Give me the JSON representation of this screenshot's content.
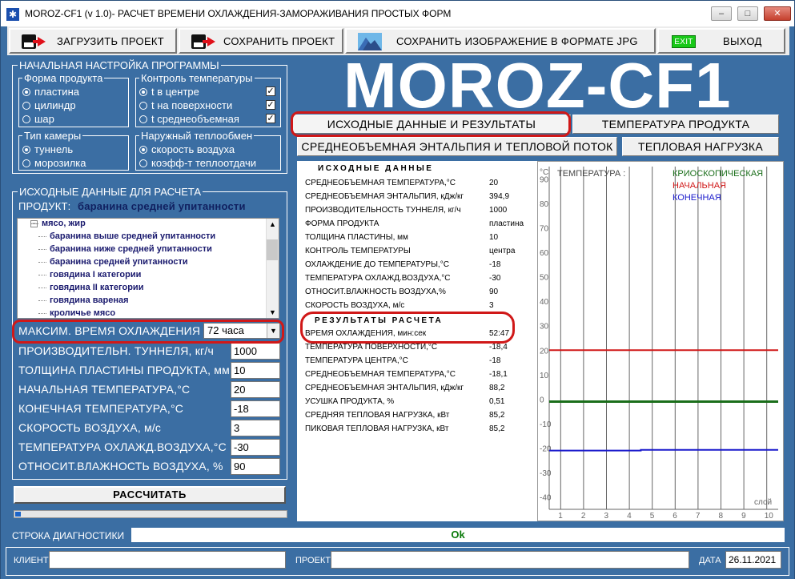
{
  "window": {
    "title": "MOROZ-CF1 (v 1.0)- РАСЧЕТ ВРЕМЕНИ ОХЛАЖДЕНИЯ-ЗАМОРАЖИВАНИЯ ПРОСТЫХ ФОРМ",
    "icon": "snowflake-icon",
    "minimize": "–",
    "maximize": "□",
    "close": "✕"
  },
  "toolbar": {
    "load": "ЗАГРУЗИТЬ  ПРОЕКТ",
    "save": "СОХРАНИТЬ  ПРОЕКТ",
    "save_image": "СОХРАНИТЬ  ИЗОБРАЖЕНИЕ  В  ФОРМАТЕ  JPG",
    "exit_icon": "EXIT",
    "exit": "ВЫХОД"
  },
  "app_title": "MOROZ-CF1",
  "settings": {
    "title": "НАЧАЛЬНАЯ НАСТРОЙКА ПРОГРАММЫ",
    "shape": {
      "title": "Форма продукта",
      "options": [
        "пластина",
        "цилиндр",
        "шар"
      ],
      "selected": 0
    },
    "temp_control": {
      "title": "Контроль температуры",
      "options": [
        "t в центре",
        "t на поверхности",
        "t среднеобъемная"
      ],
      "checked": [
        true,
        true,
        true
      ]
    },
    "chamber": {
      "title": "Тип камеры",
      "options": [
        "туннель",
        "морозилка"
      ],
      "selected": 0
    },
    "heat_exchange": {
      "title": "Наружный теплообмен",
      "options": [
        "скорость воздуха",
        "коэфф-т теплоотдачи"
      ],
      "selected": 0
    }
  },
  "input": {
    "title": "ИСХОДНЫЕ ДАННЫЕ ДЛЯ РАСЧЕТА",
    "product_label": "ПРОДУКТ:",
    "product_value": "баранина средней упитанности",
    "tree": {
      "group": "мясо, жир",
      "items": [
        "баранина выше средней упитанности",
        "баранина ниже средней упитанности",
        "баранина средней упитанности",
        "говядина I категории",
        "говядина II категории",
        "говядина вареная",
        "кроличье мясо"
      ]
    },
    "maxtime_label": "МАКСИМ. ВРЕМЯ ОХЛАЖДЕНИЯ",
    "maxtime_value": "72 часа",
    "fields": [
      {
        "label": "ПРОИЗВОДИТЕЛЬН. ТУННЕЛЯ, кг/ч",
        "value": "1000"
      },
      {
        "label": "ТОЛЩИНА ПЛАСТИНЫ ПРОДУКТА, мм",
        "value": "10"
      },
      {
        "label": "НАЧАЛЬНАЯ ТЕМПЕРАТУРА,°С",
        "value": "20"
      },
      {
        "label": "КОНЕЧНАЯ ТЕМПЕРАТУРА,°С",
        "value": "-18"
      },
      {
        "label": "СКОРОСТЬ ВОЗДУХА, м/с",
        "value": "3"
      },
      {
        "label": "ТЕМПЕРАТУРА ОХЛАЖД.ВОЗДУХА,°С",
        "value": "-30"
      },
      {
        "label": "ОТНОСИТ.ВЛАЖНОСТЬ ВОЗДУХА, %",
        "value": "90"
      }
    ],
    "calc_button": "РАССЧИТАТЬ",
    "progress": 0.02
  },
  "tabs": [
    "ИСХОДНЫЕ ДАННЫЕ И РЕЗУЛЬТАТЫ",
    "ТЕМПЕРАТУРА ПРОДУКТА",
    "СРЕДНЕОБЪЕМНАЯ ЭНТАЛЬПИЯ И ТЕПЛОВОЙ ПОТОК",
    "ТЕПЛОВАЯ  НАГРУЗКА"
  ],
  "results": {
    "input_head": "ИСХОДНЫЕ  ДАННЫЕ",
    "input_rows": [
      [
        "СРЕДНЕОБЪЕМНАЯ ТЕМПЕРАТУРА,°С",
        "20"
      ],
      [
        "СРЕДНЕОБЪЕМНАЯ ЭНТАЛЬПИЯ, кДж/кг",
        "394,9"
      ],
      [
        "ПРОИЗВОДИТЕЛЬНОСТЬ ТУННЕЛЯ, кг/ч",
        "1000"
      ],
      [
        "ФОРМА ПРОДУКТА",
        "пластина"
      ],
      [
        "ТОЛЩИНА ПЛАСТИНЫ, мм",
        "10"
      ],
      [
        "КОНТРОЛЬ ТЕМПЕРАТУРЫ",
        "центра"
      ],
      [
        "ОХЛАЖДЕНИЕ ДО ТЕМПЕРАТУРЫ,°С",
        "-18"
      ],
      [
        "ТЕМПЕРАТУРА ОХЛАЖД.ВОЗДУХА,°С",
        "-30"
      ],
      [
        "ОТНОСИТ.ВЛАЖНОСТЬ ВОЗДУХА,%",
        "90"
      ],
      [
        "СКОРОСТЬ ВОЗДУХА, м/с",
        "3"
      ]
    ],
    "result_head": "РЕЗУЛЬТАТЫ  РАСЧЕТА",
    "result_rows": [
      [
        "ВРЕМЯ ОХЛАЖДЕНИЯ, мин:сек",
        "52:47"
      ],
      [
        "ТЕМПЕРАТУРА ПОВЕРХНОСТИ,°С",
        "-18,4"
      ],
      [
        "ТЕМПЕРАТУРА ЦЕНТРА,°С",
        "-18"
      ],
      [
        "СРЕДНЕОБЪЕМНАЯ ТЕМПЕРАТУРА,°С",
        "-18,1"
      ],
      [
        "СРЕДНЕОБЪЕМНАЯ ЭНТАЛЬПИЯ, кДж/кг",
        "88,2"
      ],
      [
        "УСУШКА ПРОДУКТА, %",
        "0,51"
      ],
      [
        "СРЕДНЯЯ ТЕПЛОВАЯ НАГРУЗКА, кВт",
        "85,2"
      ],
      [
        "ПИКОВАЯ ТЕПЛОВАЯ НАГРУЗКА, кВт",
        "85,2"
      ]
    ]
  },
  "chart_data": {
    "type": "line",
    "title": "ТЕМПЕРАТУРА :",
    "yunit": "°С",
    "xlabel": "слой",
    "x": [
      1,
      2,
      3,
      4,
      5,
      6,
      7,
      8,
      9,
      10
    ],
    "ylim": [
      -45,
      95
    ],
    "yticks": [
      90,
      80,
      70,
      60,
      50,
      40,
      30,
      20,
      10,
      0,
      -10,
      -20,
      -30,
      -40
    ],
    "grid": true,
    "legend_position": "top-right",
    "series": [
      {
        "name": "КРИОСКОПИЧЕСКАЯ",
        "color": "#1a6e1a",
        "values": [
          -1,
          -1,
          -1,
          -1,
          -1,
          -1,
          -1,
          -1,
          -1,
          -1
        ]
      },
      {
        "name": "НАЧАЛЬНАЯ",
        "color": "#d01818",
        "values": [
          20,
          20,
          20,
          20,
          20,
          20,
          20,
          20,
          20,
          20
        ]
      },
      {
        "name": "КОНЕЧНАЯ",
        "color": "#1a1acc",
        "values": [
          -21,
          -21,
          -21,
          -21,
          -20.7,
          -20.7,
          -20.7,
          -20.7,
          -20.7,
          -20.7
        ]
      }
    ]
  },
  "status": {
    "label": "СТРОКА ДИАГНОСТИКИ",
    "value": "Ok"
  },
  "bottom": {
    "client_label": "КЛИЕНТ",
    "client_value": "",
    "project_label": "ПРОЕКТ",
    "project_value": "",
    "date_label": "ДАТА",
    "date_value": "26.11.2021"
  }
}
